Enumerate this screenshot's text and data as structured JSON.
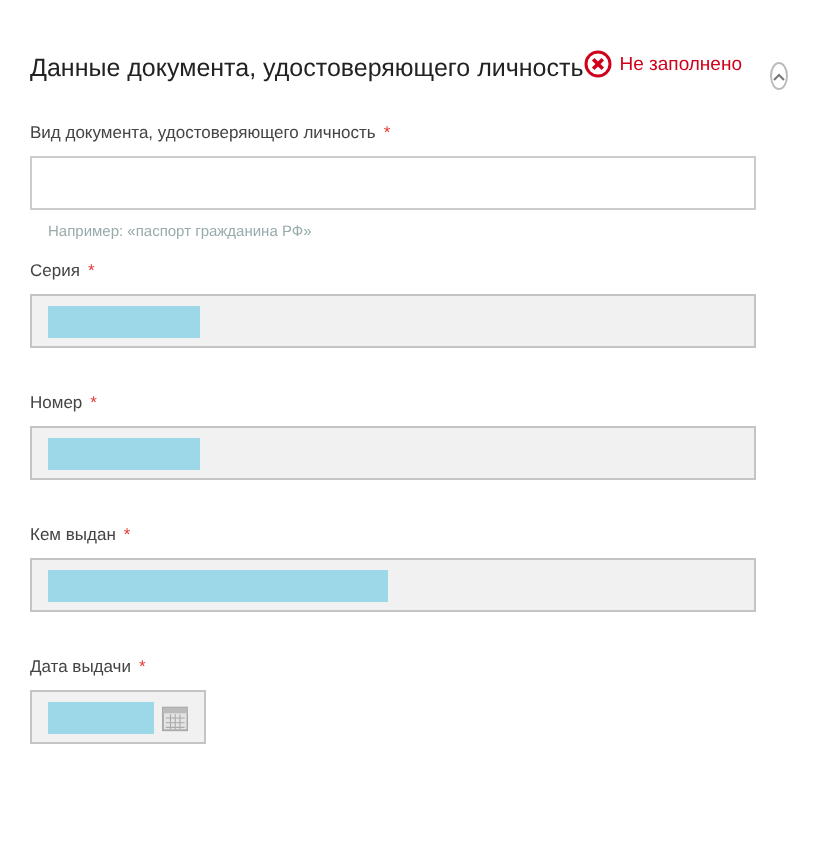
{
  "section": {
    "title": "Данные документа, удостоверяющего личность",
    "status": "Не заполнено",
    "expanded": true
  },
  "fields": [
    {
      "label": "Вид документа, удостоверяющего личность",
      "required_mark": "*",
      "kind": "text",
      "redacted": false,
      "hint": "Например: «паспорт гражданина РФ»"
    },
    {
      "label": "Серия",
      "required_mark": "*",
      "kind": "text",
      "redacted": true,
      "long_value": false
    },
    {
      "label": "Номер",
      "required_mark": "*",
      "kind": "text",
      "redacted": true,
      "long_value": false
    },
    {
      "label": "Кем выдан",
      "required_mark": "*",
      "kind": "text",
      "redacted": true,
      "long_value": true
    },
    {
      "label": "Дата выдачи",
      "required_mark": "*",
      "kind": "date",
      "redacted": true,
      "long_value": false
    }
  ]
}
